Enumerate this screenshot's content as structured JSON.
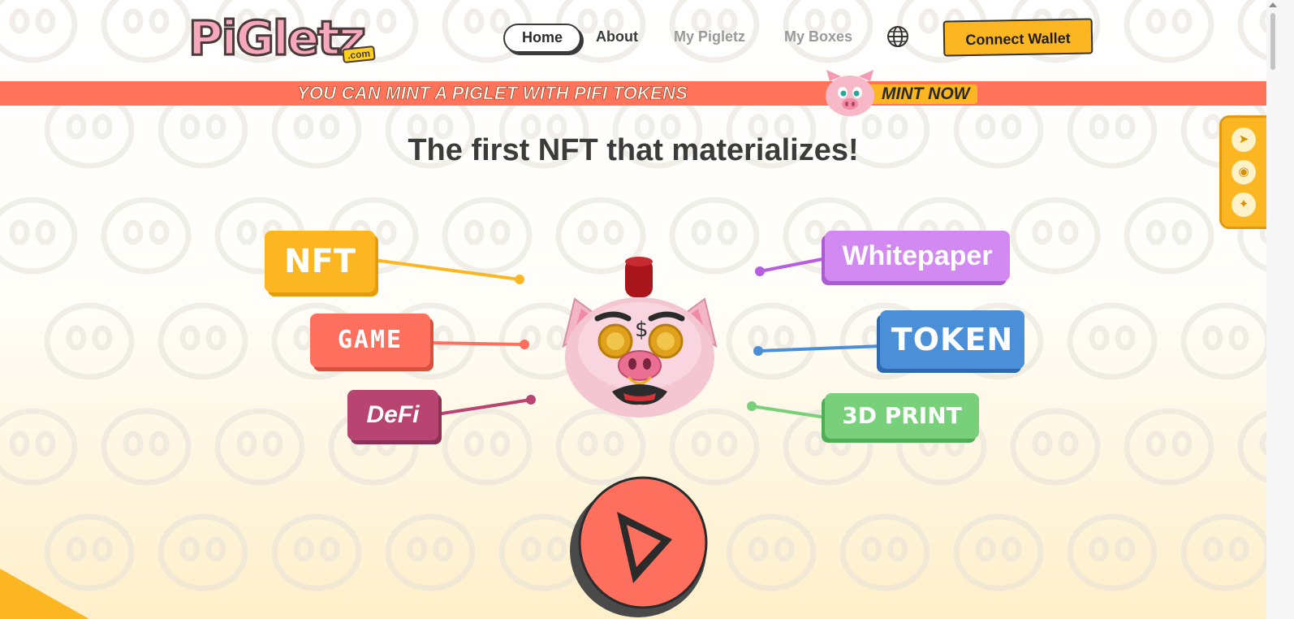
{
  "logo": {
    "text": "PiGletz",
    "suffix": ".com"
  },
  "nav": {
    "home": "Home",
    "about": "About",
    "my_pigletz": "My Pigletz",
    "my_boxes": "My Boxes",
    "language_icon": "globe-icon"
  },
  "connect_wallet": "Connect Wallet",
  "banner": {
    "text": "YOU CAN MINT A PIGLET WITH PIFI TOKENS",
    "cta": "MINT NOW"
  },
  "headline": "The first NFT that materializes!",
  "features": {
    "nft": "NFT",
    "game": "GAME",
    "defi": "DeFi",
    "whitepaper": "Whitepaper",
    "token": "TOKEN",
    "print3d": "3D PRINT"
  },
  "social": {
    "telegram": "telegram-icon",
    "discord": "discord-icon",
    "twitter": "twitter-icon"
  },
  "colors": {
    "accent_yellow": "#fbb622",
    "banner_coral": "#ff735a",
    "nft": "#fbb622",
    "game": "#ff6f5e",
    "defi": "#b84472",
    "whitepaper": "#d389f2",
    "token": "#4b8fd9",
    "print3d": "#78d07a",
    "pig_pink": "#f4c6d2"
  }
}
